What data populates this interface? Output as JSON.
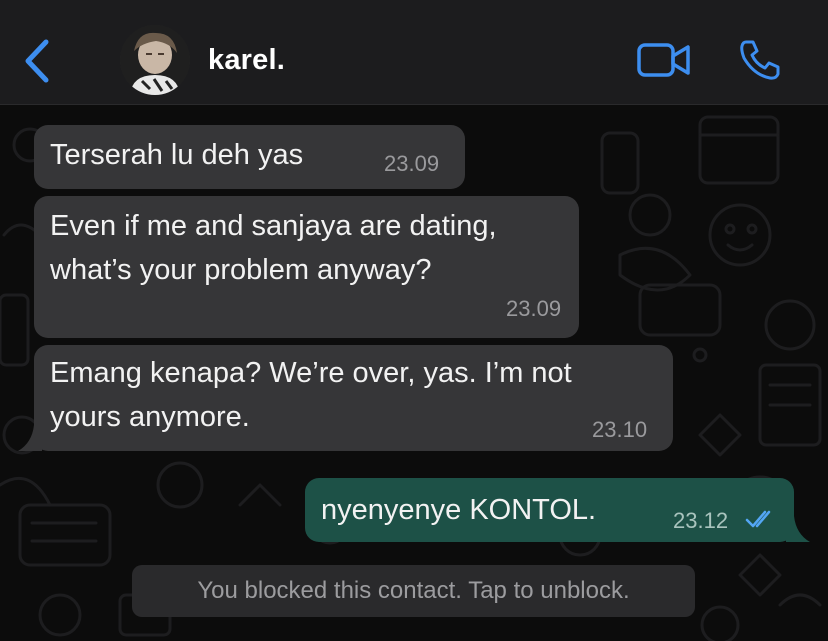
{
  "header": {
    "contact_name": "karel."
  },
  "messages": [
    {
      "direction": "in",
      "text": "Terserah lu deh yas",
      "time": "23.09"
    },
    {
      "direction": "in",
      "text": "Even if me and sanjaya are dating,\nwhat’s your problem anyway?",
      "time": "23.09"
    },
    {
      "direction": "in",
      "text": "Emang kenapa? We’re over, yas. I’m not\nyours anymore.",
      "time": "23.10"
    },
    {
      "direction": "out",
      "text": "nyenyenye KONTOL.",
      "time": "23.12",
      "status": "read"
    }
  ],
  "system_note": "You blocked this contact. Tap to unblock.",
  "colors": {
    "accent": "#3d8ef0",
    "incoming_bubble": "#363638",
    "outgoing_bubble": "#1d5147",
    "header_bg": "#1c1c1e",
    "read_ticks": "#53a6f4"
  },
  "icons": {
    "back": "chevron-left-icon",
    "video": "video-camera-icon",
    "call": "phone-icon",
    "read_status": "double-check-icon"
  }
}
